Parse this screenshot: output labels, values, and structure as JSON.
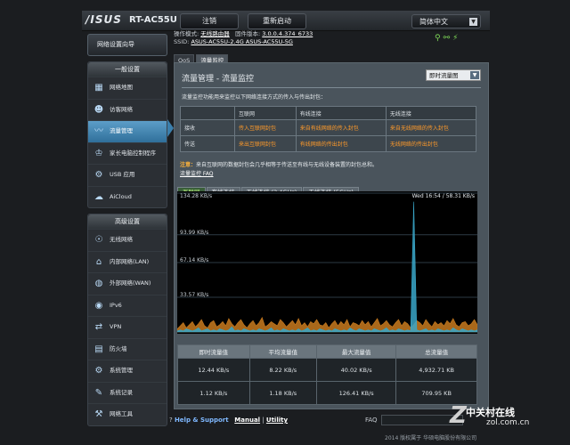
{
  "brand": {
    "logo": "/ISUS",
    "model": "RT-AC55U"
  },
  "header": {
    "logout": "注销",
    "reboot": "重新启动",
    "language": "简体中文"
  },
  "status": {
    "mode_label": "操作模式:",
    "mode_value": "无线路由器",
    "firmware_label": "固件版本:",
    "firmware_value": "3.0.0.4.374_6733",
    "ssid_label": "SSID:",
    "ssid_values": "ASUS-AC55U-2.4G  ASUS-AC55U-5G"
  },
  "sidebar": {
    "wizard": "网络设置向导",
    "general_title": "一般设置",
    "general": [
      {
        "label": "网络地图",
        "icon": "network-map-icon"
      },
      {
        "label": "访客网络",
        "icon": "guest-network-icon"
      },
      {
        "label": "流量管理",
        "icon": "traffic-manager-icon"
      },
      {
        "label": "家长电脑控制程序",
        "icon": "parental-control-icon"
      },
      {
        "label": "USB 应用",
        "icon": "usb-icon"
      },
      {
        "label": "AiCloud",
        "icon": "cloud-icon"
      }
    ],
    "advanced_title": "高级设置",
    "advanced": [
      {
        "label": "无线网络",
        "icon": "wireless-icon"
      },
      {
        "label": "内部网络(LAN)",
        "icon": "lan-icon"
      },
      {
        "label": "外部网络(WAN)",
        "icon": "wan-icon"
      },
      {
        "label": "IPv6",
        "icon": "ipv6-icon"
      },
      {
        "label": "VPN",
        "icon": "vpn-icon"
      },
      {
        "label": "防火墙",
        "icon": "firewall-icon"
      },
      {
        "label": "系统管理",
        "icon": "admin-icon"
      },
      {
        "label": "系统记录",
        "icon": "log-icon"
      },
      {
        "label": "网络工具",
        "icon": "tools-icon"
      }
    ]
  },
  "subtabs": [
    "QoS",
    "流量监控"
  ],
  "main": {
    "title": "流量管理 - 流量监控",
    "select": "即时流量图",
    "desc": "流量监控功能用来监控以下网络连接方式的传入与传出封包：",
    "legend_headers": [
      "",
      "互联网",
      "有线连接",
      "无线连接"
    ],
    "legend_rows": [
      {
        "label": "接收",
        "cells": [
          "传入互联网封包",
          "来自有线网络的传入封包",
          "来自无线网络的传入封包"
        ]
      },
      {
        "label": "传送",
        "cells": [
          "来出互联网封包",
          "有线网络的传出封包",
          "无线网络的传出封包"
        ]
      }
    ],
    "note_prefix": "注意：",
    "note": "来自互联网的数据封包会几乎相等于传送至有线与无线设备装置的封包总和。",
    "faq": "流量监控 FAQ",
    "chart_tabs": [
      "互联网",
      "有线连接",
      "无线连接 (2.4GHz)",
      "无线连接 (5GHz)"
    ],
    "stats_headers": [
      "即时流量值",
      "平均流量值",
      "最大流量值",
      "总流量值"
    ],
    "stats_rows": [
      [
        "12.44 KB/s",
        "8.22 KB/s",
        "40.02 KB/s",
        "4,932.71 KB"
      ],
      [
        "1.12 KB/s",
        "1.18 KB/s",
        "126.41 KB/s",
        "709.95 KB"
      ]
    ]
  },
  "chart_data": {
    "type": "area",
    "y_tick_labels": [
      "134.28 KB/s",
      "93.99 KB/s",
      "67.14 KB/s",
      "33.57 KB/s"
    ],
    "y_ticks": [
      134.28,
      93.99,
      67.14,
      33.57
    ],
    "time_label": "Wed 16:54 / 58.31 KB/s",
    "ylim": [
      0,
      134.28
    ],
    "series": [
      {
        "name": "received",
        "color": "#c87a1e",
        "values": [
          3,
          6,
          9,
          4,
          7,
          10,
          5,
          8,
          12,
          6,
          4,
          9,
          11,
          5,
          7,
          10,
          6,
          13,
          8,
          5,
          9,
          12,
          7,
          4,
          8,
          11,
          6,
          9,
          14,
          5,
          7,
          10,
          8,
          6,
          12,
          9,
          5,
          8,
          11,
          7,
          13,
          6,
          9,
          5,
          10,
          8,
          12,
          7,
          6,
          9,
          4,
          8,
          11,
          6,
          10,
          7,
          12,
          5,
          9,
          8,
          6,
          11,
          7,
          10,
          5,
          9,
          13,
          6,
          8,
          11,
          7,
          5,
          9,
          12,
          6,
          10,
          8,
          4,
          7,
          11,
          9,
          6,
          12,
          8,
          5,
          10,
          7,
          9,
          6,
          11,
          8,
          13,
          7,
          5,
          9,
          10,
          6,
          8,
          12,
          7
        ]
      },
      {
        "name": "sent",
        "color": "#3aa7c9",
        "values": [
          1,
          2,
          1,
          3,
          2,
          1,
          2,
          4,
          1,
          2,
          3,
          1,
          2,
          1,
          3,
          2,
          1,
          2,
          5,
          1,
          2,
          1,
          3,
          2,
          1,
          2,
          1,
          3,
          2,
          1,
          2,
          4,
          1,
          2,
          1,
          3,
          2,
          1,
          2,
          1,
          3,
          1,
          2,
          4,
          1,
          2,
          1,
          3,
          2,
          1,
          2,
          1,
          3,
          2,
          1,
          2,
          1,
          4,
          2,
          1,
          3,
          2,
          1,
          2,
          1,
          3,
          2,
          1,
          2,
          4,
          1,
          2,
          1,
          3,
          2,
          1,
          2,
          1,
          126,
          2,
          1,
          2,
          3,
          1,
          2,
          1,
          3,
          2,
          1,
          2,
          1,
          4,
          2,
          1,
          3,
          2,
          1,
          2,
          1,
          2
        ]
      }
    ]
  },
  "footer": {
    "help": "Help & Support",
    "manual": "Manual",
    "sep": "|",
    "utility": "Utility",
    "faq": "FAQ",
    "copyright": "2014 版权属于 华硕电脑股份有限公司"
  },
  "watermark": {
    "zh": "中关村在线",
    "url": "zol.com.cn"
  }
}
